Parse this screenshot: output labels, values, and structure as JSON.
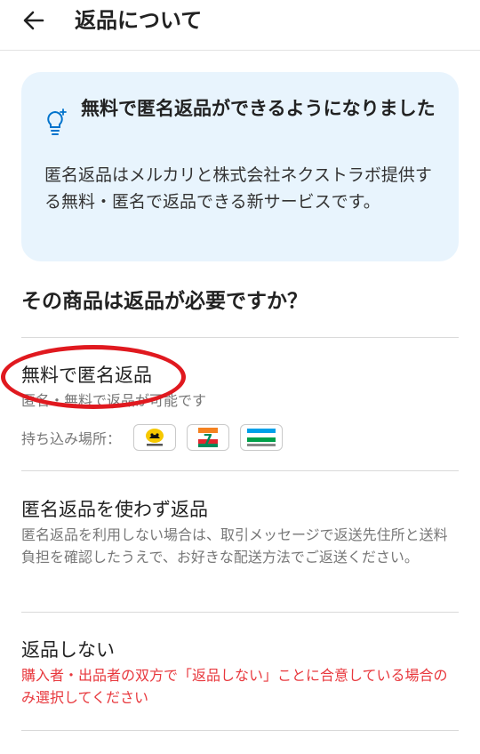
{
  "header": {
    "title": "返品について"
  },
  "info": {
    "title": "無料で匿名返品ができるようになりました",
    "body": "匿名返品はメルカリと株式会社ネクストラボ提供する無料・匿名で返品できる新サービスです。"
  },
  "question": "その商品は返品が必要ですか？",
  "options": [
    {
      "title": "無料で匿名返品",
      "desc": "匿名・無料で返品が可能です"
    },
    {
      "title": "匿名返品を使わず返品",
      "desc": "匿名返品を利用しない場合は、取引メッセージで返送先住所と送料負担を確認したうえで、お好きな配送方法でご返送ください。"
    },
    {
      "title": "返品しない",
      "warn": "購入者・出品者の双方で「返品しない」ことに合意している場合のみ選択してください"
    }
  ],
  "dropoff": {
    "label": "持ち込み場所：",
    "stores": [
      {
        "name": "yamato-logo",
        "text": "ヤマト運輸"
      },
      {
        "name": "seven-eleven-logo",
        "text": "7"
      },
      {
        "name": "familymart-logo",
        "text": "FamilyMart"
      }
    ]
  },
  "colors": {
    "accent": "#0073cc",
    "info_bg": "#e8f4fd",
    "warning": "#e8383d",
    "annotation": "#e0191f"
  }
}
